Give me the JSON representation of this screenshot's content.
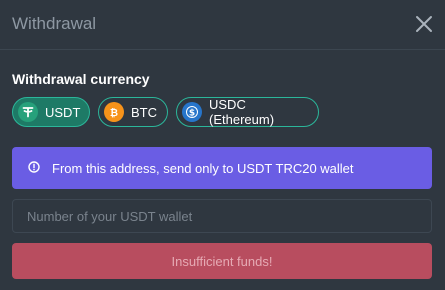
{
  "dialog": {
    "title": "Withdrawal",
    "close_icon": "close-icon"
  },
  "currency": {
    "label": "Withdrawal currency",
    "options": [
      {
        "label": "USDT",
        "icon": "tether-icon",
        "color": "#26a17b",
        "selected": true
      },
      {
        "label": "BTC",
        "icon": "bitcoin-icon",
        "color": "#f7931a",
        "selected": false
      },
      {
        "label": "USDC (Ethereum)",
        "icon": "usdc-icon",
        "color": "#2775ca",
        "selected": false
      }
    ]
  },
  "notice": {
    "icon": "info-icon",
    "text": "From this address, send only to USDT TRC20 wallet"
  },
  "wallet": {
    "placeholder": "Number of your USDT wallet",
    "value": ""
  },
  "submit": {
    "label": "Insufficient funds!"
  },
  "colors": {
    "background": "#2f3740",
    "accent": "#2bb69a",
    "notice": "#6a5de4",
    "error_button": "#b84d5f"
  }
}
